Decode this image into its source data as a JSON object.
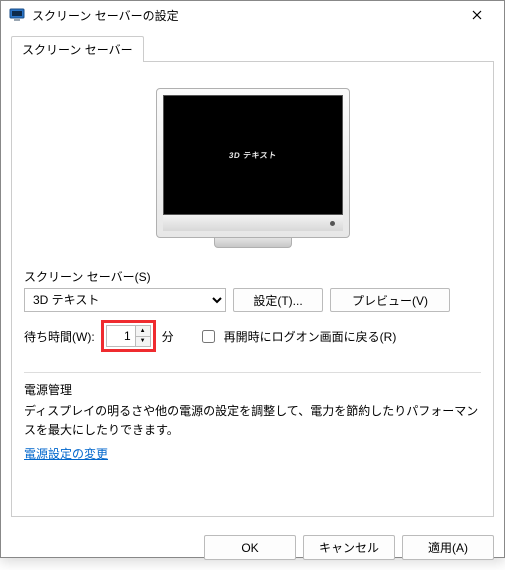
{
  "window": {
    "title": "スクリーン セーバーの設定"
  },
  "tab": {
    "label": "スクリーン セーバー"
  },
  "preview": {
    "screensaver_text": "3D テキスト"
  },
  "screensaver": {
    "group_label": "スクリーン セーバー(S)",
    "selected": "3D テキスト",
    "settings_btn": "設定(T)...",
    "preview_btn": "プレビュー(V)"
  },
  "wait": {
    "label": "待ち時間(W):",
    "value": "1",
    "unit": "分",
    "resume_checkbox_label": "再開時にログオン画面に戻る(R)",
    "resume_checked": false
  },
  "power": {
    "heading": "電源管理",
    "description": "ディスプレイの明るさや他の電源の設定を調整して、電力を節約したりパフォーマンスを最大にしたりできます。",
    "link": "電源設定の変更"
  },
  "buttons": {
    "ok": "OK",
    "cancel": "キャンセル",
    "apply": "適用(A)"
  }
}
